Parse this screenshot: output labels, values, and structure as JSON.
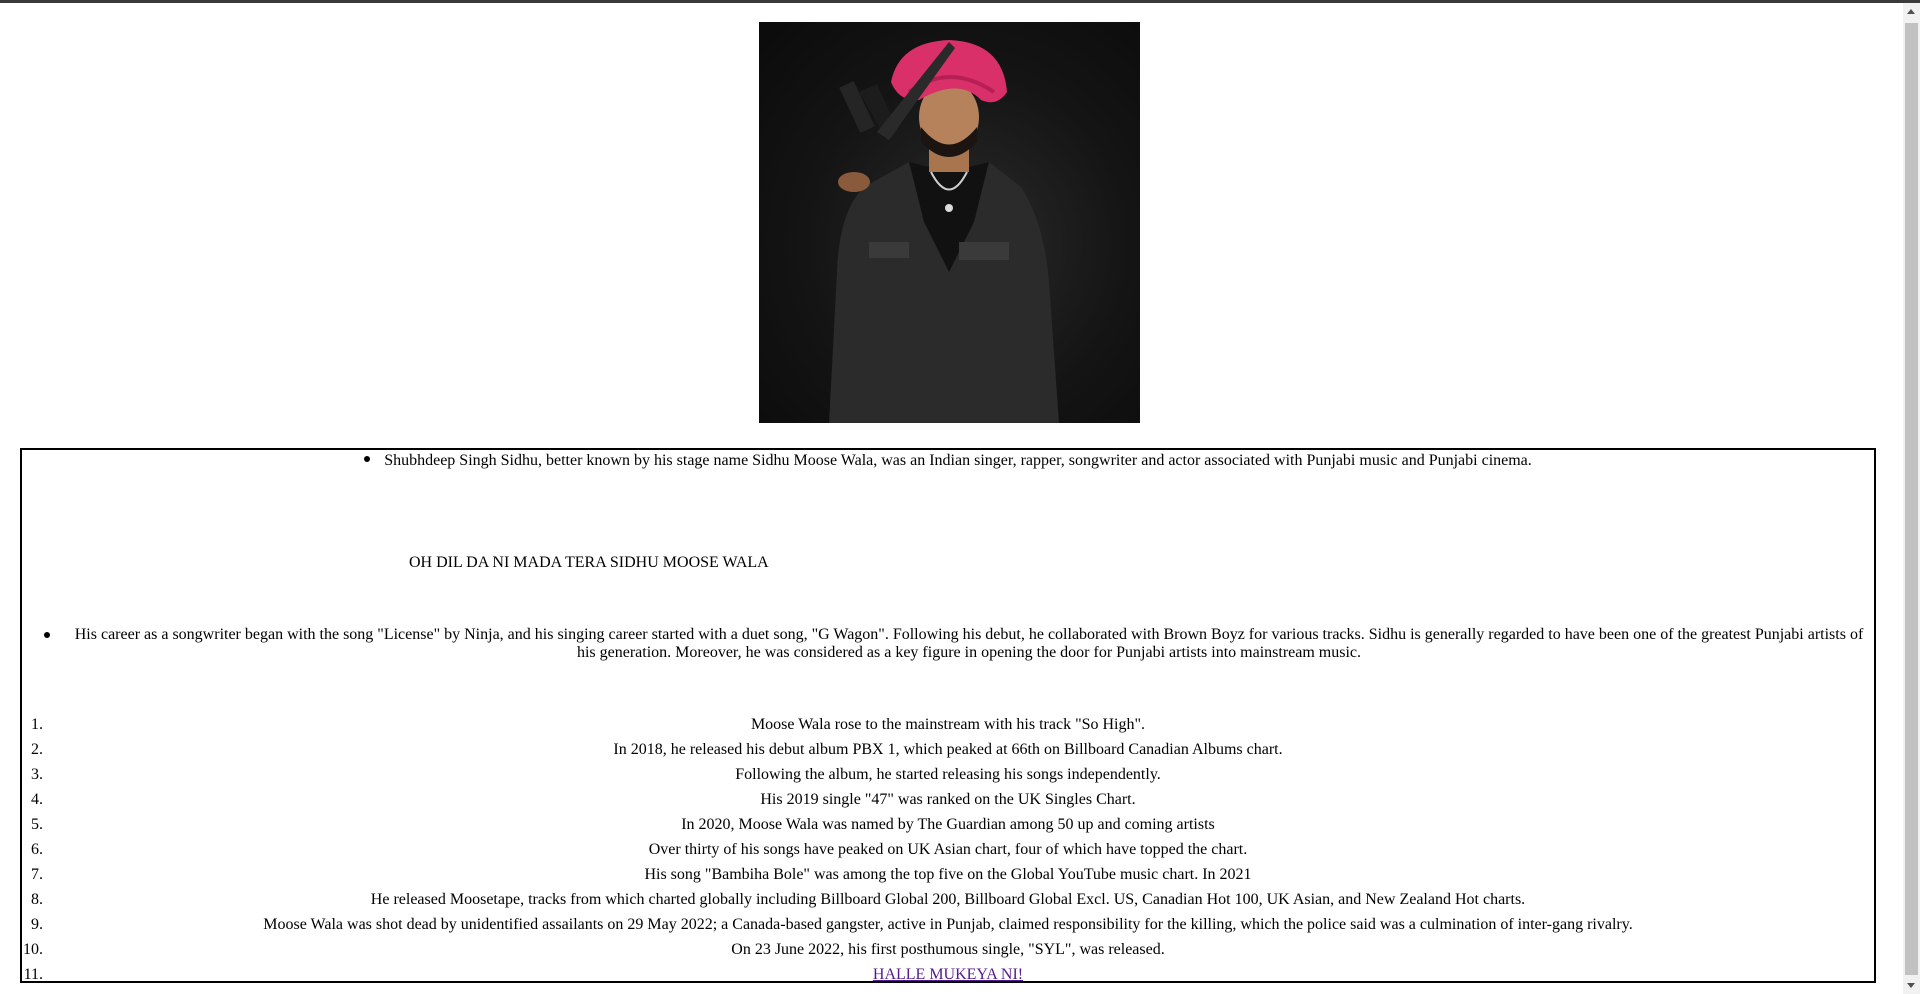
{
  "portrait": {
    "alt": "Sidhu Moose Wala portrait"
  },
  "intro_bullet": "Shubhdeep Singh Sidhu, better known by his stage name Sidhu Moose Wala, was an Indian singer, rapper, songwriter and actor associated with Punjabi music and Punjabi cinema.",
  "lyric_line": "OH DIL DA NI MADA TERA SIDHU MOOSE WALA",
  "career_bullet": "His career as a songwriter began with the song \"License\" by Ninja, and his singing career started with a duet song, \"G Wagon\". Following his debut, he collaborated with Brown Boyz for various tracks. Sidhu is generally regarded to have been one of the greatest Punjabi artists of his generation. Moreover, he was considered as a key figure in opening the door for Punjabi artists into mainstream music.",
  "facts": [
    {
      "num": "1.",
      "text": "Moose Wala rose to the mainstream with his track \"So High\"."
    },
    {
      "num": "2.",
      "text": "In 2018, he released his debut album PBX 1, which peaked at 66th on Billboard Canadian Albums chart."
    },
    {
      "num": "3.",
      "text": "Following the album, he started releasing his songs independently."
    },
    {
      "num": "4.",
      "text": "His 2019 single \"47\" was ranked on the UK Singles Chart."
    },
    {
      "num": "5.",
      "text": "In 2020, Moose Wala was named by The Guardian among 50 up and coming artists"
    },
    {
      "num": "6.",
      "text": "Over thirty of his songs have peaked on UK Asian chart, four of which have topped the chart."
    },
    {
      "num": "7.",
      "text": "His song \"Bambiha Bole\" was among the top five on the Global YouTube music chart. In 2021"
    },
    {
      "num": "8.",
      "text": "He released Moosetape, tracks from which charted globally including Billboard Global 200, Billboard Global Excl. US, Canadian Hot 100, UK Asian, and New Zealand Hot charts."
    },
    {
      "num": "9.",
      "text": "Moose Wala was shot dead by unidentified assailants on 29 May 2022; a Canada-based gangster, active in Punjab, claimed responsibility for the killing, which the police said was a culmination of inter-gang rivalry."
    },
    {
      "num": "10.",
      "text": "On 23 June 2022, his first posthumous single, \"SYL\", was released."
    },
    {
      "num": "11.",
      "link": "HALLE MUKEYA NI!"
    }
  ]
}
